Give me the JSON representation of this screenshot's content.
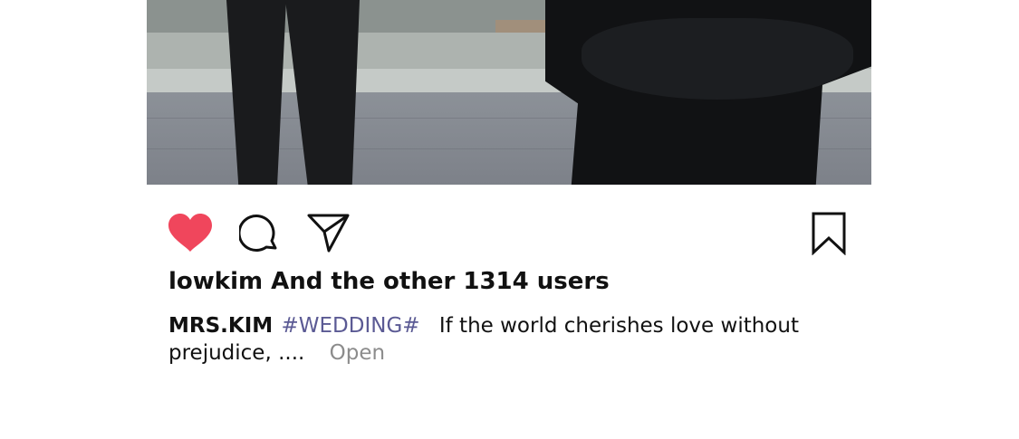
{
  "post": {
    "likes_text": "lowkim And the other 1314 users",
    "caption": {
      "author": "MRS.KIM",
      "hashtag": "#WEDDING#",
      "text_line1": "If the world cherishes love without",
      "text_line2": "prejudice, ....",
      "more_label": "Open"
    },
    "liked": true
  },
  "icons": {
    "like": "heart-icon",
    "comment": "comment-bubble-icon",
    "share": "paper-plane-icon",
    "bookmark": "bookmark-icon"
  },
  "colors": {
    "like_active": "#f0465c",
    "hashtag": "#5b5a94",
    "more_link": "#8c8c8c",
    "text": "#111111"
  }
}
